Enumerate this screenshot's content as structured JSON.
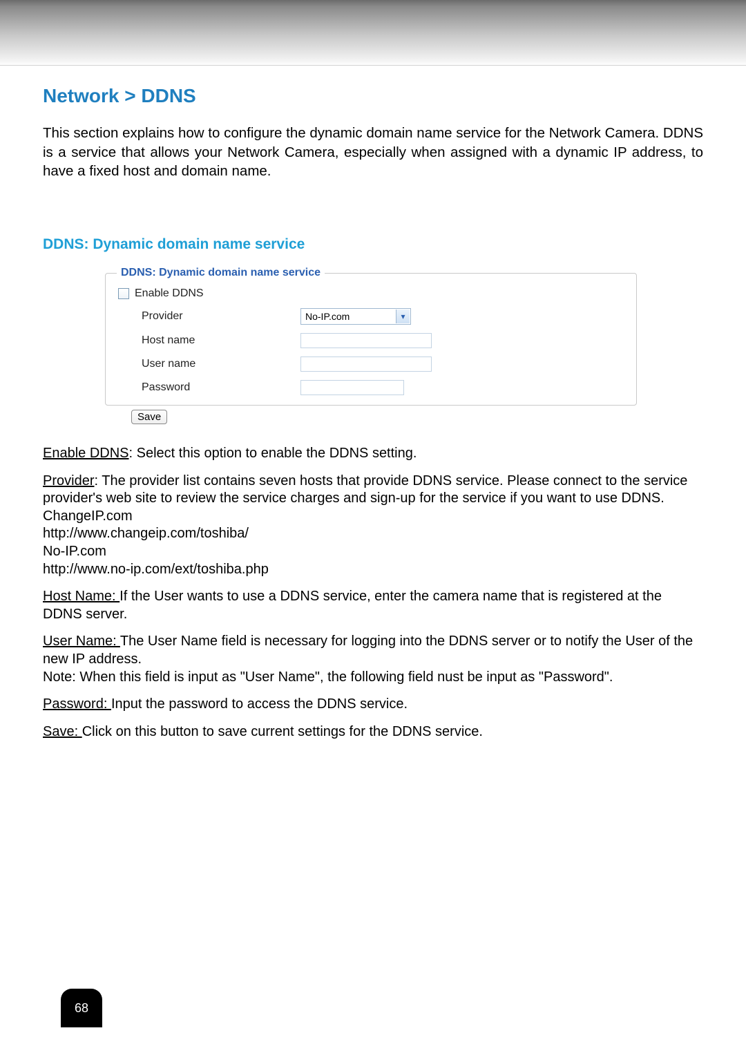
{
  "header": {
    "title": "Network > DDNS",
    "intro": "This section explains how to configure the dynamic domain name service for the Network Camera. DDNS is a service that allows your Network Camera, especially when assigned with a dynamic IP address, to have a fixed host and domain name."
  },
  "section": {
    "heading": "DDNS: Dynamic domain name service"
  },
  "panel": {
    "legend": "DDNS: Dynamic domain name service",
    "enable_label": "Enable DDNS",
    "enable_checked": false,
    "fields": {
      "provider_label": "Provider",
      "provider_value": "No-IP.com",
      "hostname_label": "Host name",
      "hostname_value": "",
      "username_label": "User name",
      "username_value": "",
      "password_label": "Password",
      "password_value": ""
    },
    "save_label": "Save"
  },
  "desc": {
    "enable_term": "Enable DDNS",
    "enable_text": ": Select this option to enable the DDNS setting.",
    "provider_term": "Provider",
    "provider_text": ": The provider list contains seven hosts that provide DDNS service. Please connect to the service provider's web site to review the service charges and sign-up for the service if you want to use DDNS.",
    "provider_list1": "ChangeIP.com",
    "provider_url1": "http://www.changeip.com/toshiba/",
    "provider_list2": "No-IP.com",
    "provider_url2": "http://www.no-ip.com/ext/toshiba.php",
    "hostname_term": "Host Name: ",
    "hostname_text": "If the User wants to use a DDNS service, enter the camera name that is registered at the DDNS server.",
    "username_term": "User Name: ",
    "username_text": "The User Name field is necessary for logging into the DDNS server or to notify the User of the new IP address.",
    "username_note": "Note: When this field is input as \"User Name\", the following field nust be input as \"Password\".",
    "password_term": "Password: ",
    "password_text": "Input the password to access the DDNS service.",
    "save_term": "Save: ",
    "save_text": "Click on this button to save current settings for the DDNS service."
  },
  "page_number": "68"
}
